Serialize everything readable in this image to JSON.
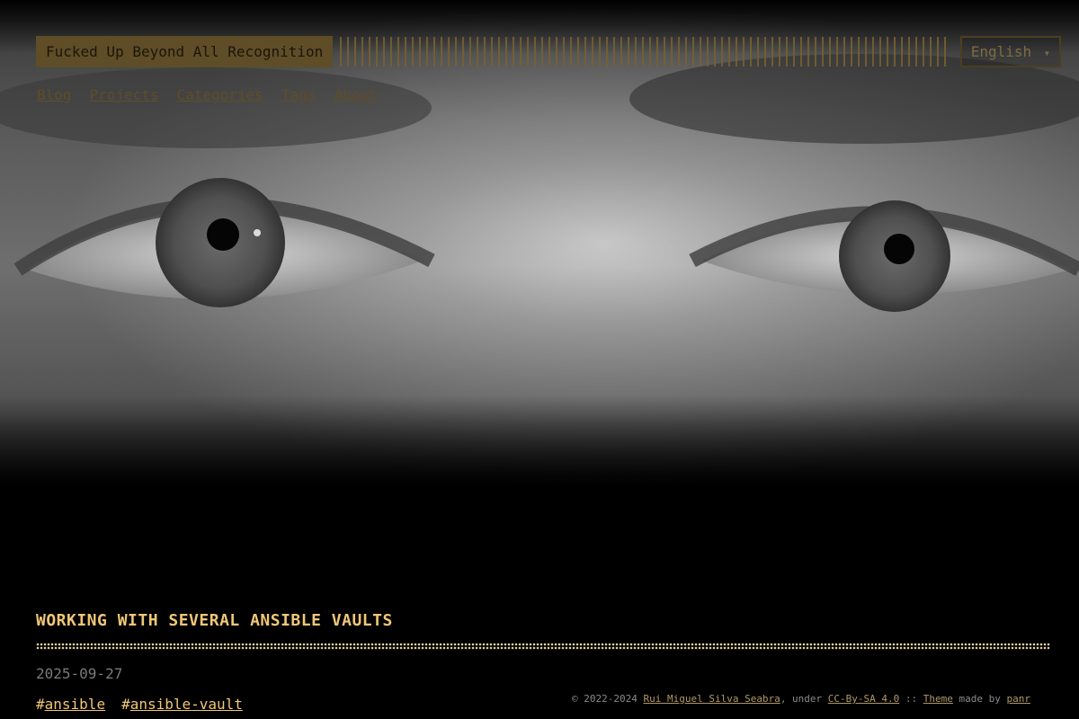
{
  "header": {
    "logo_text": "Fucked Up Beyond All Recognition",
    "language": {
      "selected": "English",
      "caret": "▾"
    }
  },
  "nav": {
    "items": [
      {
        "label": "Blog"
      },
      {
        "label": "Projects"
      },
      {
        "label": "Categories"
      },
      {
        "label": "Tags"
      },
      {
        "label": "About"
      }
    ]
  },
  "hero": {
    "description_icon": "hero-eyes-image"
  },
  "post": {
    "title": "WORKING WITH SEVERAL ANSIBLE VAULTS",
    "date": "2025-09-27",
    "tags": [
      {
        "hash": "#",
        "label": "ansible"
      },
      {
        "hash": "#",
        "label": "ansible-vault"
      }
    ]
  },
  "footer": {
    "copyright": "© 2022-2024 ",
    "author": "Rui Miguel Silva Seabra",
    "under": ", under ",
    "license": "CC-By-SA 4.0",
    "separator": " :: ",
    "theme": "Theme",
    "made_by": " made by ",
    "theme_author": "panr"
  },
  "colors": {
    "accent": "#f0c777",
    "background": "#000000",
    "nav_link": "#5e4d29",
    "logo_bg": "#5e4d26"
  }
}
